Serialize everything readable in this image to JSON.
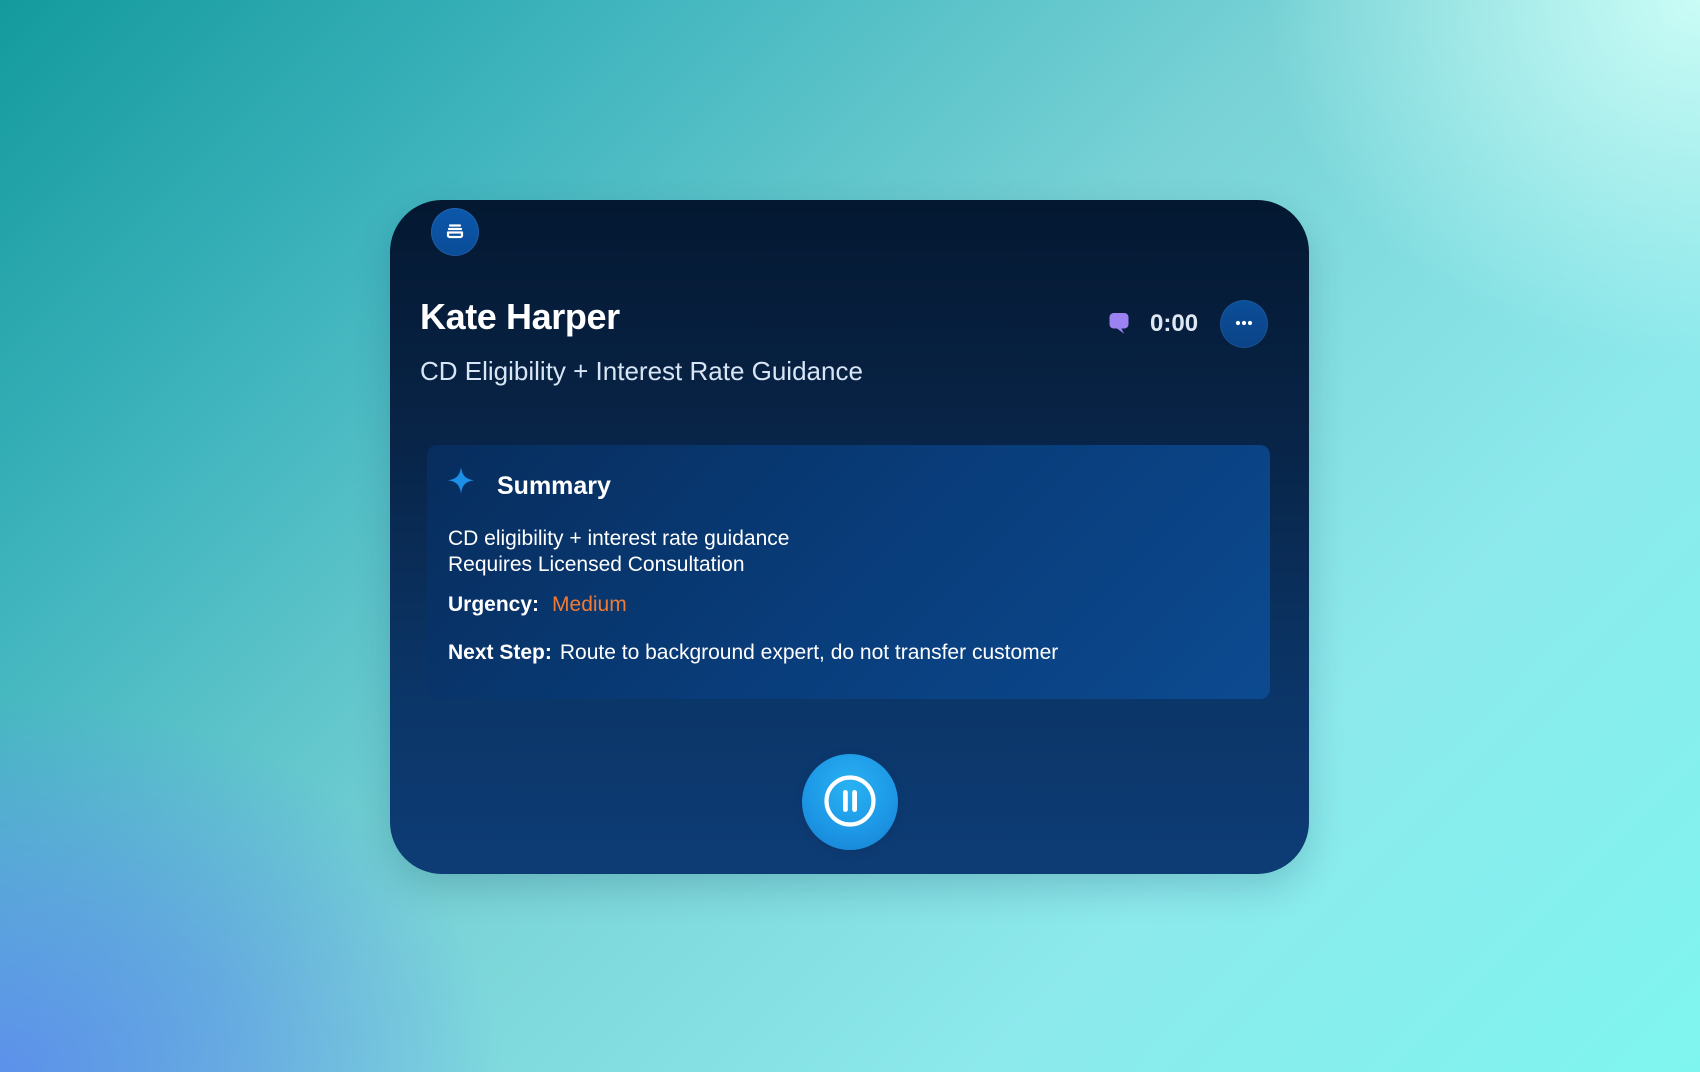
{
  "window": {
    "title": ""
  },
  "call": {
    "caller_name": "Kate Harper",
    "topic": "CD Eligibility + Interest Rate Guidance",
    "timer": "0:00"
  },
  "summary": {
    "title": "Summary",
    "line_1": "CD eligibility + interest rate guidance",
    "line_2": "Requires Licensed Consultation",
    "urgency_label": "Urgency:",
    "urgency_value": "Medium",
    "next_step_label": "Next Step:",
    "next_step_value": "Route to background expert, do not transfer customer"
  },
  "icons": {
    "logo": "stack-icon",
    "chat": "chat-bubble-icon",
    "more": "more-icon",
    "summary": "sparkle-icon",
    "pause": "pause-icon"
  },
  "colors": {
    "accent": "#1d98e6",
    "urgency": "#ef7a34",
    "chat_icon": "#9b82f2"
  }
}
